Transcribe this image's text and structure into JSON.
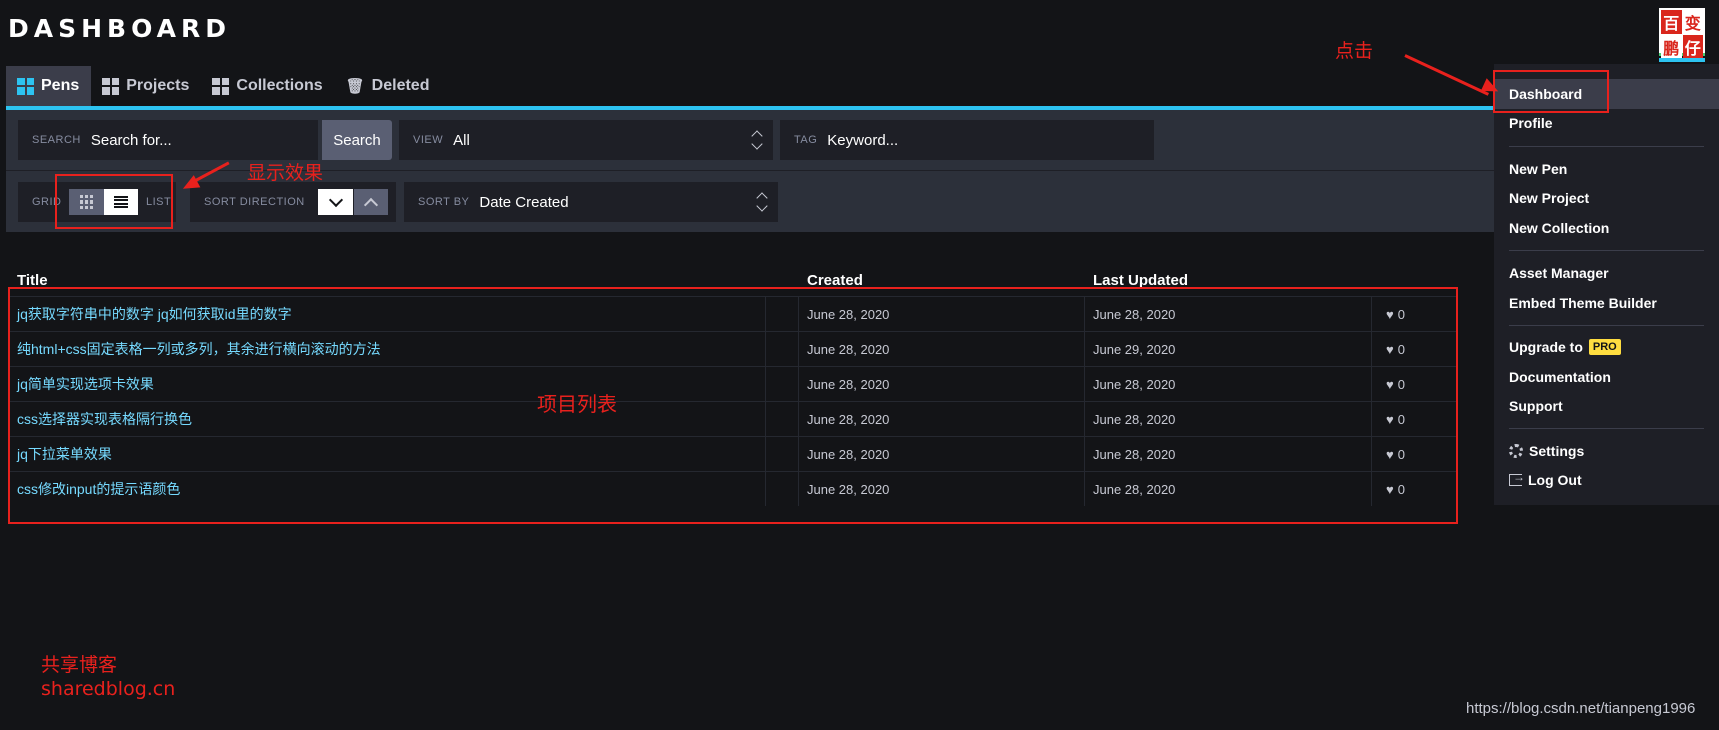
{
  "header": {
    "title": "DASHBOARD",
    "avatar_chars": [
      "百",
      "变",
      "鹏",
      "仔"
    ]
  },
  "tabs": [
    {
      "label": "Pens",
      "active": true
    },
    {
      "label": "Projects",
      "active": false
    },
    {
      "label": "Collections",
      "active": false
    },
    {
      "label": "Deleted",
      "active": false
    }
  ],
  "filters": {
    "search_label": "SEARCH",
    "search_placeholder": "Search for...",
    "search_button": "Search",
    "view_label": "VIEW",
    "view_value": "All",
    "tag_label": "TAG",
    "tag_placeholder": "Keyword...",
    "grid_label": "GRID",
    "list_label": "LIST",
    "sort_direction_label": "SORT DIRECTION",
    "sort_by_label": "SORT BY",
    "sort_by_value": "Date Created"
  },
  "table": {
    "headers": {
      "title": "Title",
      "created": "Created",
      "updated": "Last Updated"
    },
    "rows": [
      {
        "title": "jq获取字符串中的数字 jq如何获取id里的数字",
        "created": "June 28, 2020",
        "updated": "June 28, 2020",
        "likes": "0"
      },
      {
        "title": "纯html+css固定表格一列或多列，其余进行横向滚动的方法",
        "created": "June 28, 2020",
        "updated": "June 29, 2020",
        "likes": "0"
      },
      {
        "title": "jq简单实现选项卡效果",
        "created": "June 28, 2020",
        "updated": "June 28, 2020",
        "likes": "0"
      },
      {
        "title": "css选择器实现表格隔行换色",
        "created": "June 28, 2020",
        "updated": "June 28, 2020",
        "likes": "0"
      },
      {
        "title": "jq下拉菜单效果",
        "created": "June 28, 2020",
        "updated": "June 28, 2020",
        "likes": "0"
      },
      {
        "title": "css修改input的提示语颜色",
        "created": "June 28, 2020",
        "updated": "June 28, 2020",
        "likes": "0"
      }
    ]
  },
  "menu": {
    "dashboard": "Dashboard",
    "profile": "Profile",
    "new_pen": "New Pen",
    "new_project": "New Project",
    "new_collection": "New Collection",
    "asset_manager": "Asset Manager",
    "embed_theme_builder": "Embed Theme Builder",
    "upgrade_to": "Upgrade to",
    "pro_badge": "PRO",
    "documentation": "Documentation",
    "support": "Support",
    "settings": "Settings",
    "log_out": "Log Out"
  },
  "annotations": {
    "click": "点击",
    "display_effect": "显示效果",
    "project_list": "项目列表",
    "blog_name": "共享博客",
    "blog_url": "sharedblog.cn",
    "watermark": "https://blog.csdn.net/tianpeng1996"
  },
  "colors": {
    "accent": "#2dc3f1",
    "link": "#76daff",
    "annotation": "#e8211d",
    "pro": "#ffdd40"
  }
}
